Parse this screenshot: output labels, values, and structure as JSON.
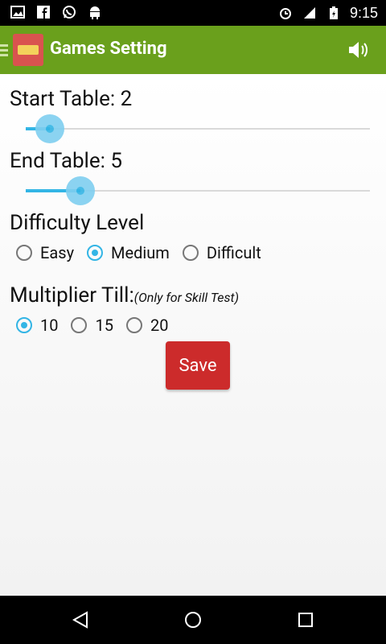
{
  "status_bar": {
    "time": "9:15",
    "left_icons": [
      "picture-icon",
      "facebook-icon",
      "whatsapp-icon",
      "android-icon"
    ],
    "right_icons": [
      "alarm-icon",
      "signal-icon",
      "battery-icon"
    ]
  },
  "app_bar": {
    "title": "Games Setting",
    "icons": {
      "menu": "hamburger-icon",
      "logo": "app-logo-icon",
      "sound": "speaker-icon"
    },
    "accent": "#6aa01c"
  },
  "settings": {
    "start_table": {
      "label": "Start Table: 2",
      "value": 2,
      "level": 0.07
    },
    "end_table": {
      "label": "End Table: 5",
      "value": 5,
      "level": 0.16
    },
    "difficulty": {
      "title": "Difficulty Level",
      "options": [
        "Easy",
        "Medium",
        "Difficult"
      ],
      "selected": "Medium"
    },
    "multiplier": {
      "title": "Multiplier Till:",
      "note": "(Only for Skill Test)",
      "options": [
        "10",
        "15",
        "20"
      ],
      "selected": "10"
    },
    "save_label": "Save",
    "save_color": "#cc2b2b",
    "slider_color": "#33b5e5"
  },
  "nav_bar": {
    "icons": [
      "back-icon",
      "home-icon",
      "recents-icon"
    ]
  }
}
